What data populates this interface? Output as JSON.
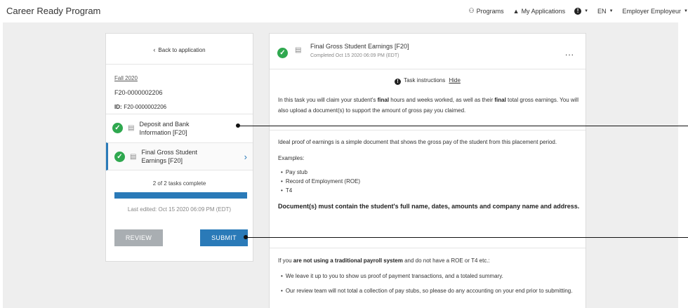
{
  "header": {
    "brand": "Career Ready Program",
    "nav": [
      {
        "icon": "programs-icon",
        "glyph": "⚲",
        "label": "Programs"
      },
      {
        "icon": "trophy-icon",
        "glyph": "🏆",
        "label": "My Applications"
      }
    ],
    "help_icon": "info-icon",
    "language": "EN",
    "user": "Employer Employeur"
  },
  "sidebar": {
    "back_label": "Back to application",
    "term": "Fall 2020",
    "application_code": "F20-0000002206",
    "id_label": "ID:",
    "id_value": "F20-0000002206",
    "tasks": [
      {
        "label": "Deposit and Bank Information [F20]",
        "status": "complete"
      },
      {
        "label": "Final Gross Student Earnings [F20]",
        "status": "complete",
        "active": true
      }
    ],
    "progress_text": "2 of 2 tasks complete",
    "progress_fraction": 1.0,
    "progress_color": "#2a7ab8",
    "last_edited": "Last edited: Oct 15 2020 06:09 PM (EDT)",
    "review_label": "REVIEW",
    "submit_label": "SUBMIT"
  },
  "task_panel": {
    "title": "Final Gross Student Earnings [F20]",
    "completed": "Completed Oct 15 2020 06:09 PM (EDT)",
    "more_label": "...",
    "instructions_label": "Task instructions",
    "hide_label": "Hide",
    "p1_a": "In this task you will claim your student's ",
    "p1_b": "final",
    "p1_c": " hours and weeks worked, as well as their ",
    "p1_d": "final",
    "p1_e": " total gross earnings. You will also upload a document(s) to support the amount of gross pay you claimed.",
    "p2": "Ideal proof of earnings is a simple document that shows the gross pay of the student from this placement period.",
    "examples_label": "Examples:",
    "examples": [
      "Pay stub",
      "Record of Employment (ROE)",
      "T4"
    ],
    "requirement": "Document(s) must contain the student's full name, dates, amounts and company name and address.",
    "p3_a": "If you ",
    "p3_b": "are not using a traditional payroll system",
    "p3_c": " and do not have a ROE or T4 etc.:",
    "bullets2": [
      "We leave it up to you to show us proof of payment transactions, and a totaled summary.",
      "Our review team will not total a collection of pay stubs, so please do any accounting on your end prior to submitting."
    ]
  },
  "colors": {
    "accent": "#2a7ab8",
    "success": "#2fa84f",
    "muted_button": "#a9aeb2"
  }
}
